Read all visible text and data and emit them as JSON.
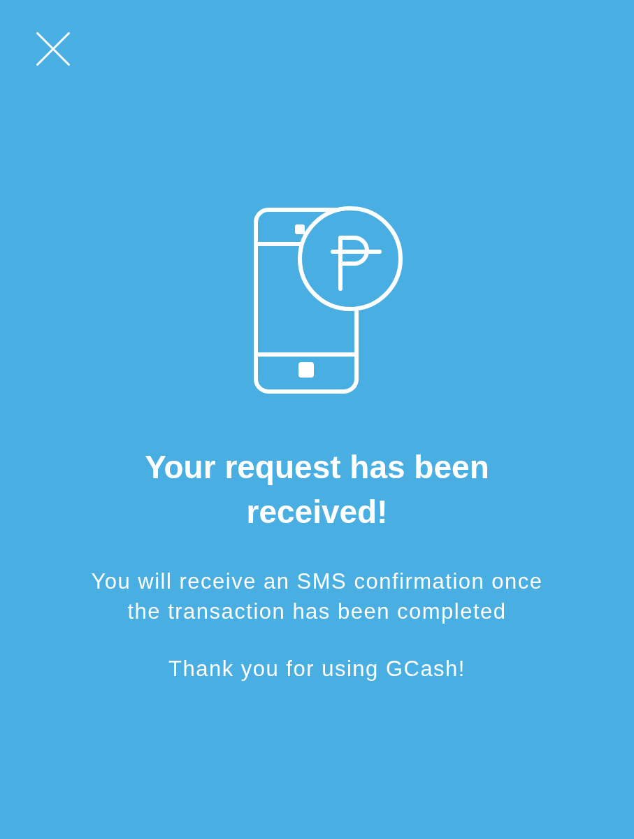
{
  "title": "Your request has been received!",
  "message": "You will receive an SMS confirmation once the transaction has been completed",
  "thanks": "Thank you for using GCash!"
}
